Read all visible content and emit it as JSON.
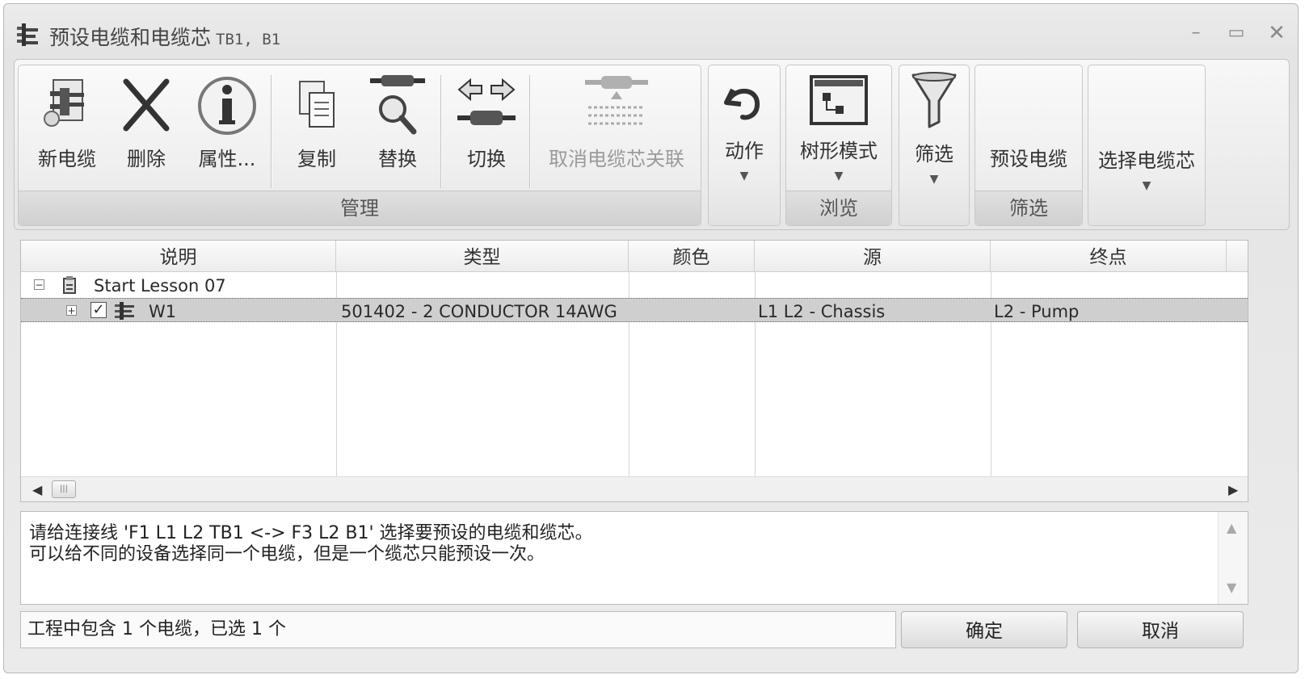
{
  "window": {
    "title": "预设电缆和电缆芯",
    "subtitle": "TB1, B1"
  },
  "ribbon": {
    "manage_group": {
      "label": "管理",
      "buttons": {
        "new_cable": "新电缆",
        "delete": "删除",
        "properties": "属性...",
        "copy": "复制",
        "replace": "替换",
        "switch": "切换",
        "unassign_core": "取消电缆芯关联"
      }
    },
    "action": {
      "label": "动作"
    },
    "browse_group": {
      "label": "浏览",
      "tree_mode": "树形模式"
    },
    "filter": {
      "label": "筛选"
    },
    "filter_group": {
      "label": "筛选",
      "preset_cable": "预设电缆"
    },
    "select_core": {
      "label": "选择电缆芯"
    }
  },
  "table": {
    "columns": [
      "说明",
      "类型",
      "颜色",
      "源",
      "终点"
    ],
    "rows": [
      {
        "desc": "Start Lesson 07",
        "type": "",
        "color": "",
        "source": "",
        "target": ""
      },
      {
        "desc": "W1",
        "type": "501402 - 2 CONDUCTOR 14AWG",
        "color": "",
        "source": "L1 L2 - Chassis",
        "target": "L2 - Pump",
        "checked": true
      }
    ]
  },
  "message": {
    "line1": "请给连接线 'F1 L1 L2 TB1 <-> F3 L2 B1' 选择要预设的电缆和缆芯。",
    "line2": "可以给不同的设备选择同一个电缆，但是一个缆芯只能预设一次。"
  },
  "status": "工程中包含 1 个电缆，已选 1 个",
  "buttons": {
    "ok": "确定",
    "cancel": "取消"
  }
}
